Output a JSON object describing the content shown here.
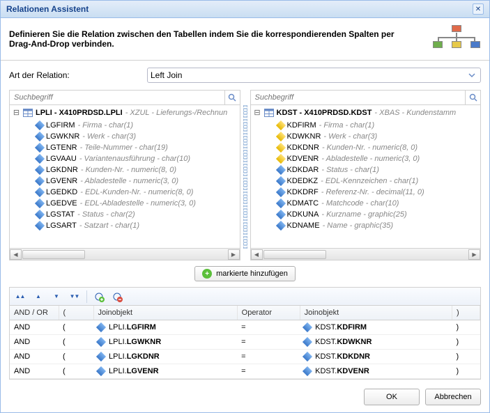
{
  "title": "Relationen Assistent",
  "description": "Definieren Sie die Relation zwischen den Tabellen indem Sie die korrespondierenden Spalten per Drag-And-Drop verbinden.",
  "relation_type_label": "Art der Relation:",
  "relation_type_value": "Left Join",
  "search_placeholder": "Suchbegriff",
  "left_table": {
    "code": "LPLI - X410PRDSD.LPLI",
    "rest": " - XZUL - Lieferungs-/Rechnun",
    "columns": [
      {
        "name": "LGFIRM",
        "desc": "Firma - char(1)",
        "key": false
      },
      {
        "name": "LGWKNR",
        "desc": "Werk - char(3)",
        "key": false
      },
      {
        "name": "LGTENR",
        "desc": "Teile-Nummer - char(19)",
        "key": false
      },
      {
        "name": "LGVAAU",
        "desc": "Variantenausführung - char(10)",
        "key": false
      },
      {
        "name": "LGKDNR",
        "desc": "Kunden-Nr. - numeric(8, 0)",
        "key": false
      },
      {
        "name": "LGVENR",
        "desc": "Abladestelle - numeric(3, 0)",
        "key": false
      },
      {
        "name": "LGEDKD",
        "desc": "EDL-Kunden-Nr. - numeric(8, 0)",
        "key": false
      },
      {
        "name": "LGEDVE",
        "desc": "EDL-Abladestelle - numeric(3, 0)",
        "key": false
      },
      {
        "name": "LGSTAT",
        "desc": "Status - char(2)",
        "key": false
      },
      {
        "name": "LGSART",
        "desc": "Satzart - char(1)",
        "key": false
      }
    ]
  },
  "right_table": {
    "code": "KDST - X410PRDSD.KDST",
    "rest": " - XBAS - Kundenstamm",
    "columns": [
      {
        "name": "KDFIRM",
        "desc": "Firma - char(1)",
        "key": true
      },
      {
        "name": "KDWKNR",
        "desc": "Werk - char(3)",
        "key": true
      },
      {
        "name": "KDKDNR",
        "desc": "Kunden-Nr. - numeric(8, 0)",
        "key": true
      },
      {
        "name": "KDVENR",
        "desc": "Abladestelle - numeric(3, 0)",
        "key": true
      },
      {
        "name": "KDKDAR",
        "desc": "Status - char(1)",
        "key": false
      },
      {
        "name": "KDEDKZ",
        "desc": "EDL-Kennzeichen - char(1)",
        "key": false
      },
      {
        "name": "KDKDRF",
        "desc": "Referenz-Nr. - decimal(11, 0)",
        "key": false
      },
      {
        "name": "KDMATC",
        "desc": "Matchcode - char(10)",
        "key": false
      },
      {
        "name": "KDKUNA",
        "desc": "Kurzname - graphic(25)",
        "key": false
      },
      {
        "name": "KDNAME",
        "desc": "Name - graphic(35)",
        "key": false
      }
    ]
  },
  "add_button_label": "markierte hinzufügen",
  "grid": {
    "headers": {
      "andor": "AND / OR",
      "p1": "(",
      "join1": "Joinobjekt",
      "op": "Operator",
      "join2": "Joinobjekt",
      "p2": ")"
    },
    "rows": [
      {
        "andor": "AND",
        "p1": "(",
        "l_prefix": "LPLI.",
        "l_col": "LGFIRM",
        "op": "=",
        "r_prefix": "KDST.",
        "r_col": "KDFIRM",
        "p2": ")"
      },
      {
        "andor": "AND",
        "p1": "(",
        "l_prefix": "LPLI.",
        "l_col": "LGWKNR",
        "op": "=",
        "r_prefix": "KDST.",
        "r_col": "KDWKNR",
        "p2": ")"
      },
      {
        "andor": "AND",
        "p1": "(",
        "l_prefix": "LPLI.",
        "l_col": "LGKDNR",
        "op": "=",
        "r_prefix": "KDST.",
        "r_col": "KDKDNR",
        "p2": ")"
      },
      {
        "andor": "AND",
        "p1": "(",
        "l_prefix": "LPLI.",
        "l_col": "LGVENR",
        "op": "=",
        "r_prefix": "KDST.",
        "r_col": "KDVENR",
        "p2": ")"
      }
    ]
  },
  "ok_label": "OK",
  "cancel_label": "Abbrechen"
}
